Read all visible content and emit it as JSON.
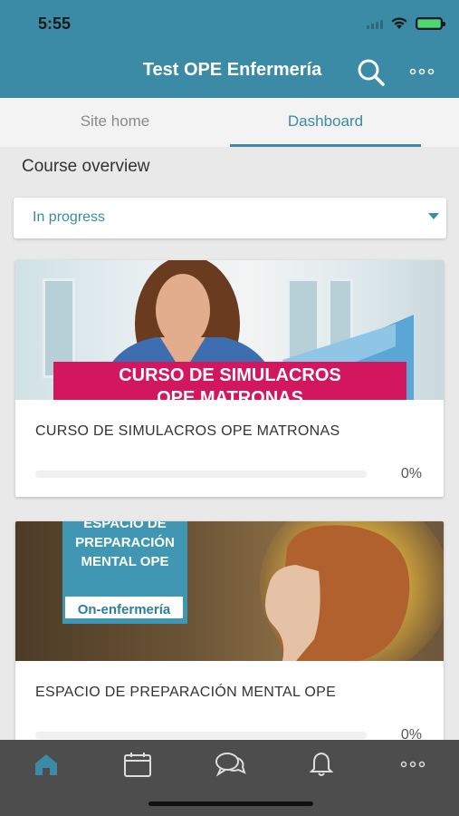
{
  "status_bar": {
    "time": "5:55"
  },
  "app": {
    "title": "Test OPE Enfermería"
  },
  "tabs": [
    {
      "label": "Site home",
      "active": false
    },
    {
      "label": "Dashboard",
      "active": true
    }
  ],
  "section": {
    "title": "Course overview"
  },
  "filter": {
    "selected": "In progress"
  },
  "courses": [
    {
      "name": "CURSO DE SIMULACROS OPE MATRONAS",
      "image_text_line1": "CURSO DE SIMULACROS",
      "image_text_line2": "OPE MATRONAS",
      "progress_label": "0%",
      "progress": 0
    },
    {
      "name": "ESPACIO DE PREPARACIÓN MENTAL OPE",
      "image_text_line1": "ESPACIO DE",
      "image_text_line2": "PREPARACIÓN",
      "image_text_line3": "MENTAL OPE",
      "image_logo_text": "On-enfermería",
      "progress_label": "0%",
      "progress": 0
    }
  ],
  "bottom_nav": [
    {
      "icon": "home-icon",
      "active": true
    },
    {
      "icon": "calendar-icon",
      "active": false
    },
    {
      "icon": "messages-icon",
      "active": false
    },
    {
      "icon": "bell-icon",
      "active": false
    },
    {
      "icon": "more-icon",
      "active": false
    }
  ],
  "colors": {
    "brand": "#3b8aa6",
    "banner_pink": "#d3175f",
    "nav_bg": "#4d4d4d"
  }
}
